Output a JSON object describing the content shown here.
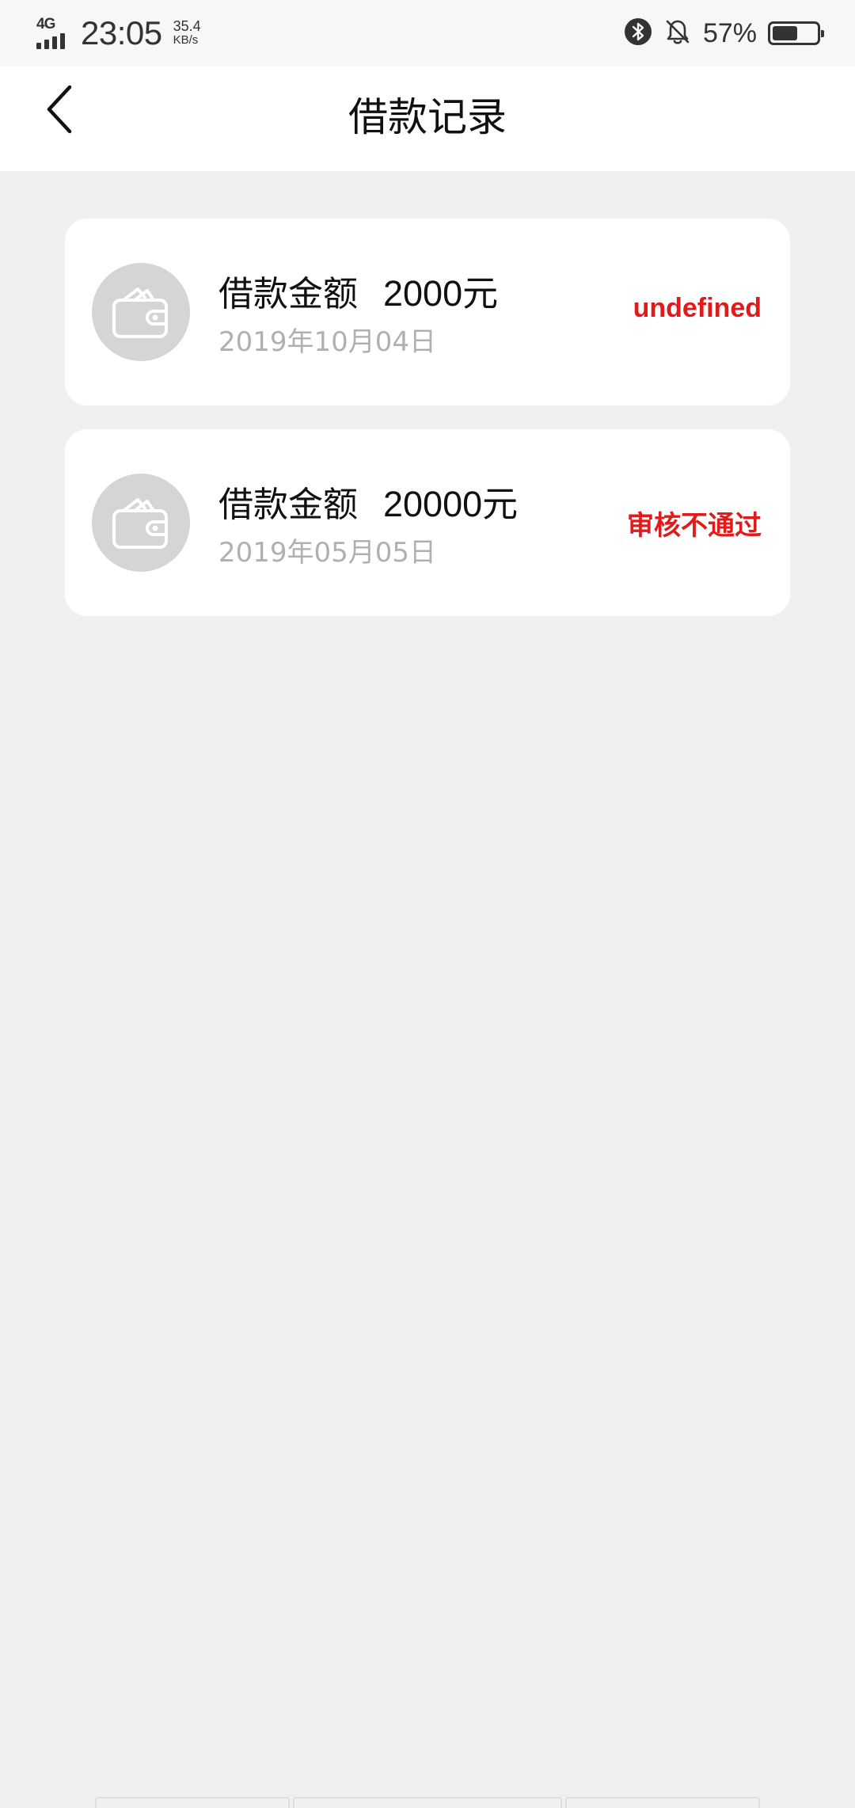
{
  "status_bar": {
    "network": "4G",
    "time": "23:05",
    "speed_value": "35.4",
    "speed_unit": "KB/s",
    "battery_percent": "57%",
    "battery_level": 0.57,
    "icons": [
      "signal-icon",
      "bluetooth-icon",
      "bell-off-icon",
      "battery-icon"
    ]
  },
  "header": {
    "title": "借款记录",
    "back_icon": "chevron-left-icon"
  },
  "records": [
    {
      "amount_label": "借款金额",
      "amount": "2000元",
      "date": "2019年10月04日",
      "status": "undefined",
      "icon": "wallet-icon"
    },
    {
      "amount_label": "借款金额",
      "amount": "20000元",
      "date": "2019年05月05日",
      "status": "审核不通过",
      "icon": "wallet-icon"
    }
  ],
  "colors": {
    "background": "#f0f0f0",
    "card": "#ffffff",
    "status_red": "#e11b1b",
    "date_gray": "#b0b0b0",
    "avatar_gray": "#d5d5d5"
  }
}
